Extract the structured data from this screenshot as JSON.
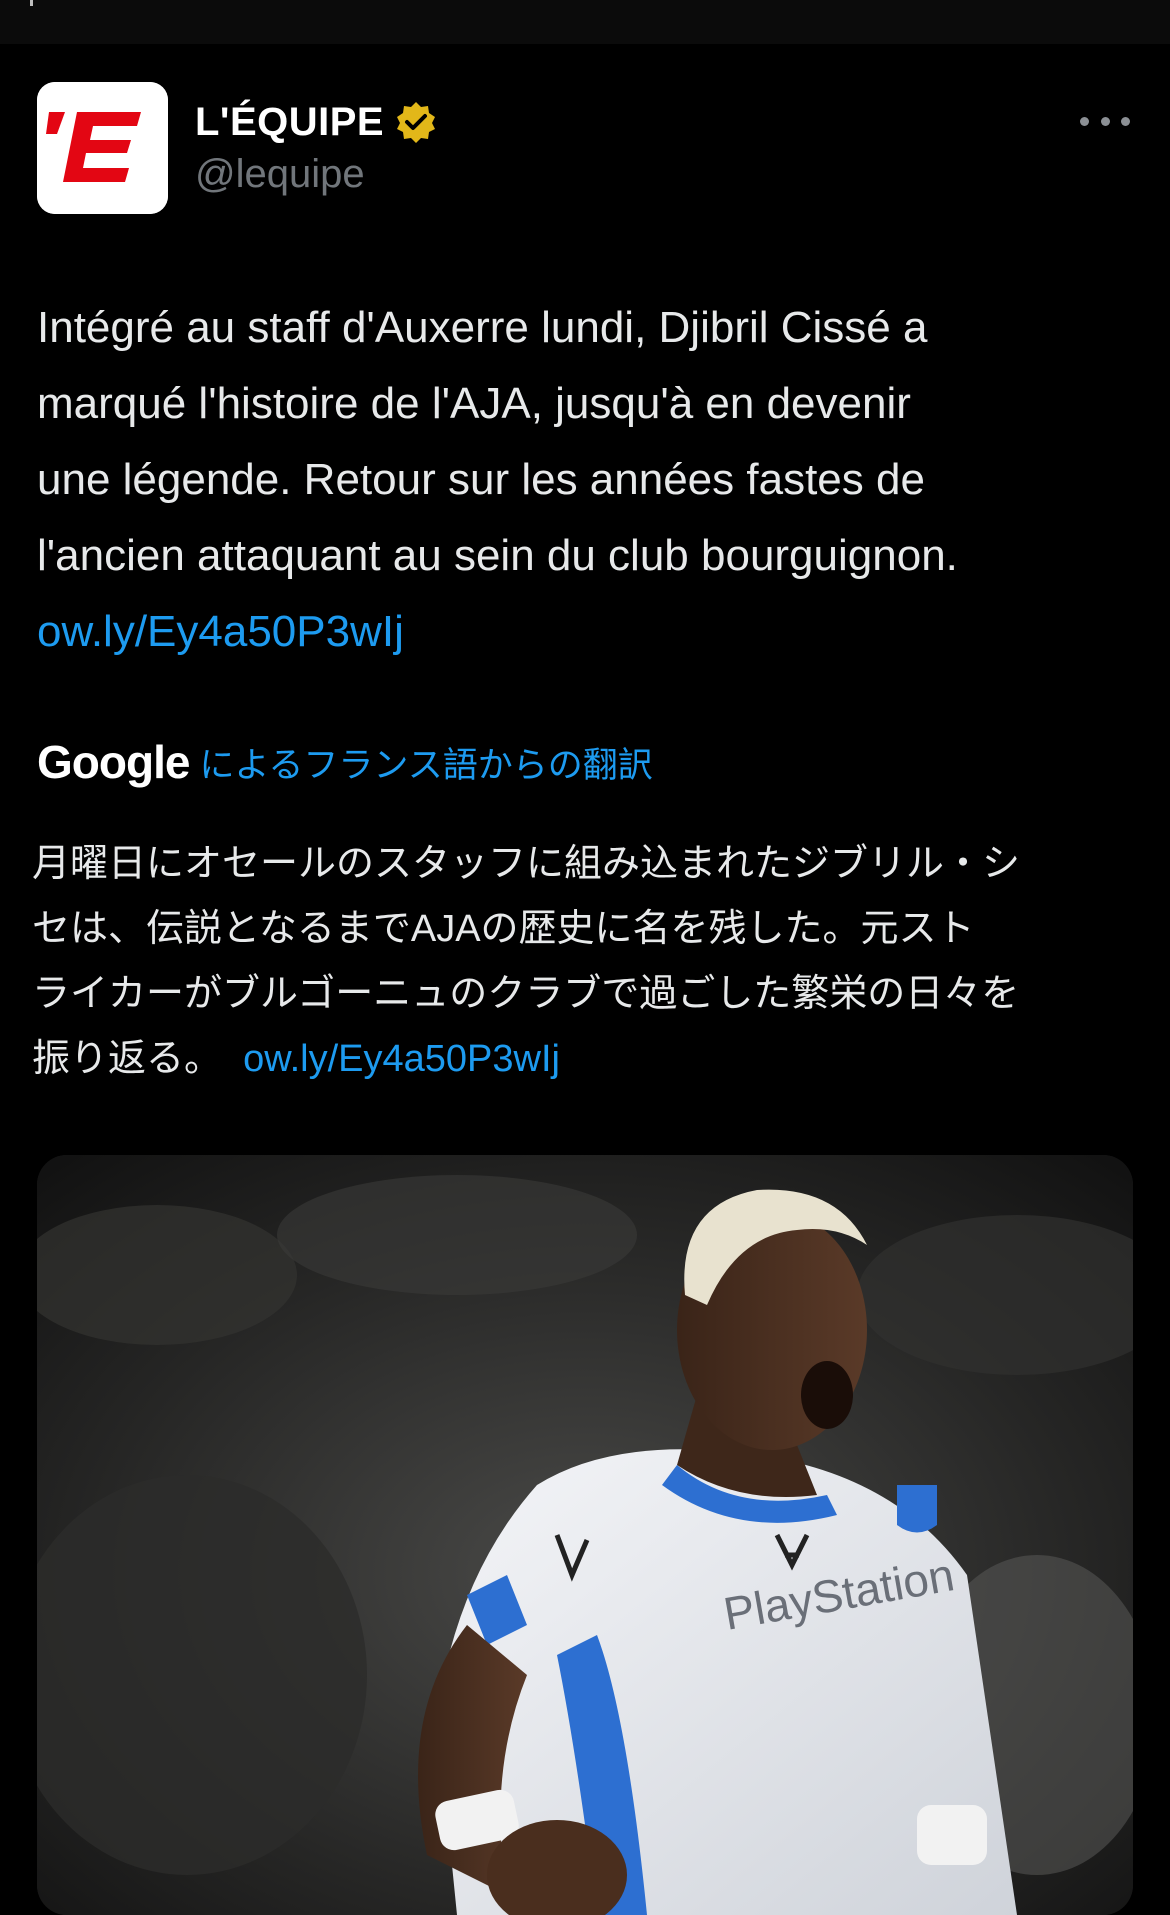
{
  "tweet": {
    "author": {
      "name": "L'ÉQUIPE",
      "handle": "@lequipe",
      "avatar_text": "'E",
      "avatar_colors": {
        "background": "#ffffff",
        "logo": "#e30613"
      },
      "verified_badge_color": "#e2b719"
    },
    "more_icon": "ellipsis-icon",
    "text_lines": [
      "Intégré au staff d'Auxerre lundi, Djibril Cissé a",
      "marqué l'histoire de l'AJA, jusqu'à en devenir",
      "une légende. Retour sur les années fastes de",
      "l'ancien attaquant au sein du club bourguignon."
    ],
    "link": "ow.ly/Ey4a50P3wIj",
    "translation": {
      "provider": "Google",
      "note": "によるフランス語からの翻訳",
      "lines": [
        "月曜日にオセールのスタッフに組み込まれたジブリル・シ",
        "セは、伝説となるまでAJAの歴史に名を残した。元スト",
        "ライカーがブルゴーニュのクラブで過ごした繁栄の日々を",
        "振り返る。"
      ],
      "link": "ow.ly/Ey4a50P3wIj"
    },
    "media": {
      "shirt_sponsor": "PlayStation"
    }
  },
  "colors": {
    "background": "#000000",
    "text": "#e7e9ea",
    "secondary_text": "#71767b",
    "link": "#1d9bf0"
  }
}
